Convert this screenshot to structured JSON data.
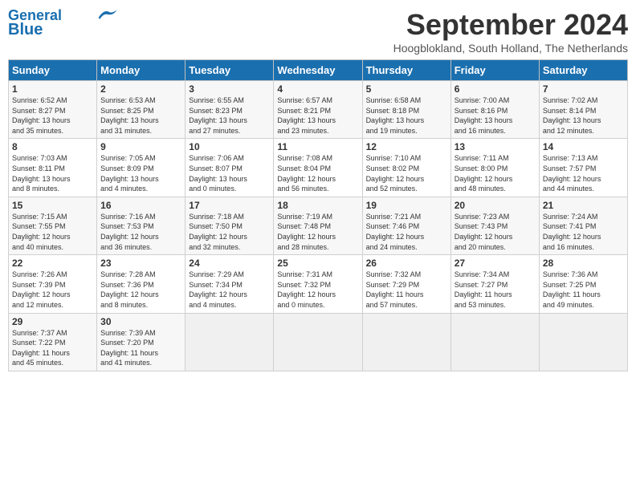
{
  "header": {
    "logo_line1": "General",
    "logo_line2": "Blue",
    "month_title": "September 2024",
    "subtitle": "Hoogblokland, South Holland, The Netherlands"
  },
  "weekdays": [
    "Sunday",
    "Monday",
    "Tuesday",
    "Wednesday",
    "Thursday",
    "Friday",
    "Saturday"
  ],
  "weeks": [
    [
      {
        "day": "1",
        "info": "Sunrise: 6:52 AM\nSunset: 8:27 PM\nDaylight: 13 hours\nand 35 minutes."
      },
      {
        "day": "2",
        "info": "Sunrise: 6:53 AM\nSunset: 8:25 PM\nDaylight: 13 hours\nand 31 minutes."
      },
      {
        "day": "3",
        "info": "Sunrise: 6:55 AM\nSunset: 8:23 PM\nDaylight: 13 hours\nand 27 minutes."
      },
      {
        "day": "4",
        "info": "Sunrise: 6:57 AM\nSunset: 8:21 PM\nDaylight: 13 hours\nand 23 minutes."
      },
      {
        "day": "5",
        "info": "Sunrise: 6:58 AM\nSunset: 8:18 PM\nDaylight: 13 hours\nand 19 minutes."
      },
      {
        "day": "6",
        "info": "Sunrise: 7:00 AM\nSunset: 8:16 PM\nDaylight: 13 hours\nand 16 minutes."
      },
      {
        "day": "7",
        "info": "Sunrise: 7:02 AM\nSunset: 8:14 PM\nDaylight: 13 hours\nand 12 minutes."
      }
    ],
    [
      {
        "day": "8",
        "info": "Sunrise: 7:03 AM\nSunset: 8:11 PM\nDaylight: 13 hours\nand 8 minutes."
      },
      {
        "day": "9",
        "info": "Sunrise: 7:05 AM\nSunset: 8:09 PM\nDaylight: 13 hours\nand 4 minutes."
      },
      {
        "day": "10",
        "info": "Sunrise: 7:06 AM\nSunset: 8:07 PM\nDaylight: 13 hours\nand 0 minutes."
      },
      {
        "day": "11",
        "info": "Sunrise: 7:08 AM\nSunset: 8:04 PM\nDaylight: 12 hours\nand 56 minutes."
      },
      {
        "day": "12",
        "info": "Sunrise: 7:10 AM\nSunset: 8:02 PM\nDaylight: 12 hours\nand 52 minutes."
      },
      {
        "day": "13",
        "info": "Sunrise: 7:11 AM\nSunset: 8:00 PM\nDaylight: 12 hours\nand 48 minutes."
      },
      {
        "day": "14",
        "info": "Sunrise: 7:13 AM\nSunset: 7:57 PM\nDaylight: 12 hours\nand 44 minutes."
      }
    ],
    [
      {
        "day": "15",
        "info": "Sunrise: 7:15 AM\nSunset: 7:55 PM\nDaylight: 12 hours\nand 40 minutes."
      },
      {
        "day": "16",
        "info": "Sunrise: 7:16 AM\nSunset: 7:53 PM\nDaylight: 12 hours\nand 36 minutes."
      },
      {
        "day": "17",
        "info": "Sunrise: 7:18 AM\nSunset: 7:50 PM\nDaylight: 12 hours\nand 32 minutes."
      },
      {
        "day": "18",
        "info": "Sunrise: 7:19 AM\nSunset: 7:48 PM\nDaylight: 12 hours\nand 28 minutes."
      },
      {
        "day": "19",
        "info": "Sunrise: 7:21 AM\nSunset: 7:46 PM\nDaylight: 12 hours\nand 24 minutes."
      },
      {
        "day": "20",
        "info": "Sunrise: 7:23 AM\nSunset: 7:43 PM\nDaylight: 12 hours\nand 20 minutes."
      },
      {
        "day": "21",
        "info": "Sunrise: 7:24 AM\nSunset: 7:41 PM\nDaylight: 12 hours\nand 16 minutes."
      }
    ],
    [
      {
        "day": "22",
        "info": "Sunrise: 7:26 AM\nSunset: 7:39 PM\nDaylight: 12 hours\nand 12 minutes."
      },
      {
        "day": "23",
        "info": "Sunrise: 7:28 AM\nSunset: 7:36 PM\nDaylight: 12 hours\nand 8 minutes."
      },
      {
        "day": "24",
        "info": "Sunrise: 7:29 AM\nSunset: 7:34 PM\nDaylight: 12 hours\nand 4 minutes."
      },
      {
        "day": "25",
        "info": "Sunrise: 7:31 AM\nSunset: 7:32 PM\nDaylight: 12 hours\nand 0 minutes."
      },
      {
        "day": "26",
        "info": "Sunrise: 7:32 AM\nSunset: 7:29 PM\nDaylight: 11 hours\nand 57 minutes."
      },
      {
        "day": "27",
        "info": "Sunrise: 7:34 AM\nSunset: 7:27 PM\nDaylight: 11 hours\nand 53 minutes."
      },
      {
        "day": "28",
        "info": "Sunrise: 7:36 AM\nSunset: 7:25 PM\nDaylight: 11 hours\nand 49 minutes."
      }
    ],
    [
      {
        "day": "29",
        "info": "Sunrise: 7:37 AM\nSunset: 7:22 PM\nDaylight: 11 hours\nand 45 minutes."
      },
      {
        "day": "30",
        "info": "Sunrise: 7:39 AM\nSunset: 7:20 PM\nDaylight: 11 hours\nand 41 minutes."
      },
      {
        "day": "",
        "info": ""
      },
      {
        "day": "",
        "info": ""
      },
      {
        "day": "",
        "info": ""
      },
      {
        "day": "",
        "info": ""
      },
      {
        "day": "",
        "info": ""
      }
    ]
  ]
}
